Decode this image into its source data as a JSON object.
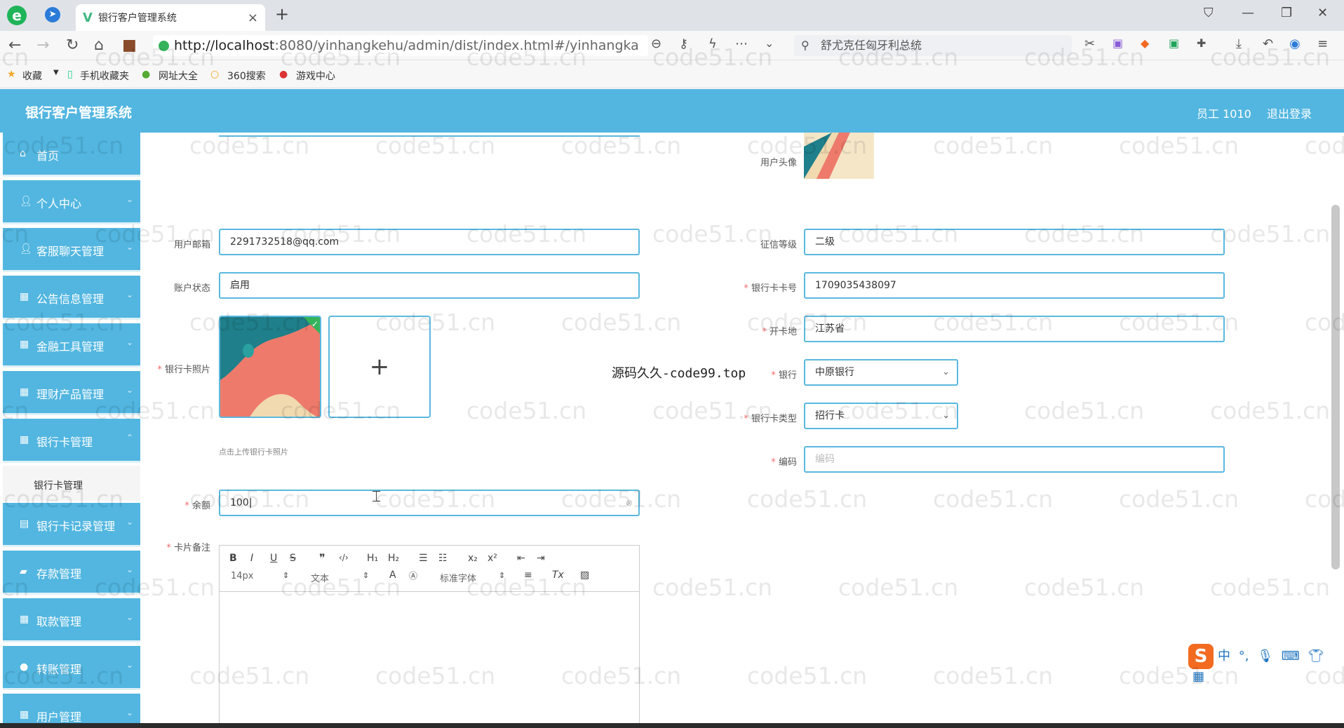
{
  "browser": {
    "tab_title": "银行客户管理系统",
    "url_host": "http://localhost",
    "url_rest": ":8080/yinhangkehu/admin/dist/index.html#/yinhangka",
    "search_text": "舒尤克任匈牙利总统",
    "bookmarks": [
      "收藏",
      "手机收藏夹",
      "网址大全",
      "360搜索",
      "游戏中心"
    ]
  },
  "app": {
    "title": "银行客户管理系统",
    "user": "员工 1010",
    "logout": "退出登录"
  },
  "sidebar": {
    "items": [
      {
        "label": "首页",
        "icon": "home-icon"
      },
      {
        "label": "个人中心",
        "icon": "user-icon"
      },
      {
        "label": "客服聊天管理",
        "icon": "user-icon"
      },
      {
        "label": "公告信息管理",
        "icon": "grid-icon"
      },
      {
        "label": "金融工具管理",
        "icon": "grid-icon"
      },
      {
        "label": "理财产品管理",
        "icon": "grid-icon"
      },
      {
        "label": "银行卡管理",
        "icon": "grid-icon"
      },
      {
        "label": "银行卡记录管理",
        "icon": "doc-icon"
      },
      {
        "label": "存款管理",
        "icon": "chat-icon"
      },
      {
        "label": "取款管理",
        "icon": "grid-icon"
      },
      {
        "label": "转账管理",
        "icon": "pin-icon"
      },
      {
        "label": "用户管理",
        "icon": "grid-icon"
      }
    ],
    "sub_item": "银行卡管理"
  },
  "form": {
    "avatar_label": "用户头像",
    "email_label": "用户邮箱",
    "email_value": "2291732518@qq.com",
    "credit_label": "征信等级",
    "credit_value": "二级",
    "status_label": "账户状态",
    "status_value": "启用",
    "card_no_label": "银行卡卡号",
    "card_no_value": "1709035438097",
    "open_place_label": "开卡地",
    "open_place_value": "江苏省",
    "photo_label": "银行卡照片",
    "bank_label": "银行",
    "bank_value": "中原银行",
    "card_type_label": "银行卡类型",
    "card_type_value": "招行卡",
    "code_label": "编码",
    "code_placeholder": "编码",
    "upload_tip": "点击上传银行卡照片",
    "balance_label": "余额",
    "balance_value": "100",
    "remark_label": "卡片备注",
    "overlay_text": "源码久久-code99.top"
  },
  "editor": {
    "font_size": "14px",
    "text_type": "文本",
    "font_family": "标准字体"
  },
  "watermark": "code51.cn",
  "ime": {
    "label": "中"
  }
}
